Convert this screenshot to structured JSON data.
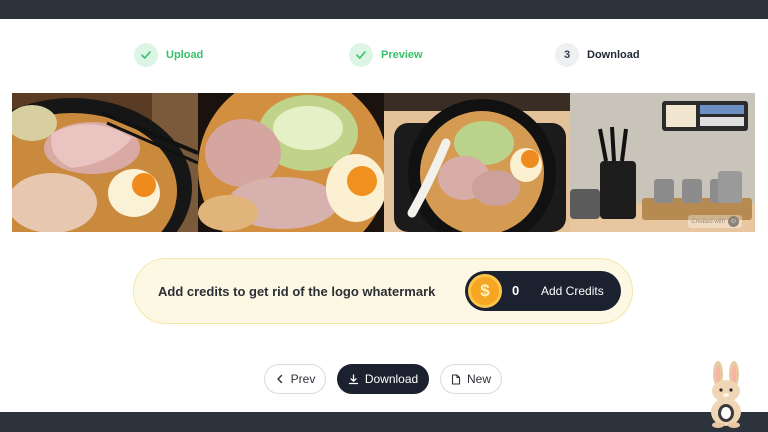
{
  "steps": [
    {
      "label": "Upload",
      "state": "done"
    },
    {
      "label": "Preview",
      "state": "done"
    },
    {
      "number": "3",
      "label": "Download",
      "state": "current"
    }
  ],
  "photos": [
    {
      "subject": "ramen-chashu-chopsticks"
    },
    {
      "subject": "ramen-bowl-topdown"
    },
    {
      "subject": "ramen-bowl-on-tray"
    },
    {
      "subject": "table-condiments"
    }
  ],
  "watermark": {
    "text": "Created with"
  },
  "banner": {
    "message": "Add credits to get rid of the logo whatermark",
    "coin_symbol": "$",
    "credits": "0",
    "add_credits_label": "Add Credits"
  },
  "actions": {
    "prev_label": "Prev",
    "download_label": "Download",
    "new_label": "New"
  },
  "colors": {
    "accent_green": "#34c26a",
    "dark": "#1c2130",
    "bar": "#2d333d",
    "banner_bg": "#fdf8e3",
    "coin": "#f6a623"
  },
  "icons": [
    "check-icon",
    "chevron-left-icon",
    "download-icon",
    "file-icon",
    "coin-icon",
    "rabbit-mascot"
  ]
}
